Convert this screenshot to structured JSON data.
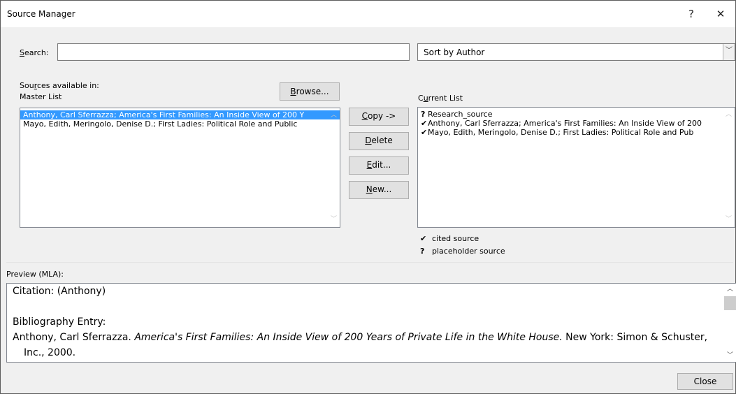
{
  "window": {
    "title": "Source Manager",
    "help": "?",
    "close": "✕"
  },
  "search": {
    "label_pre": "",
    "label_u": "S",
    "label_post": "earch:",
    "value": ""
  },
  "sort": {
    "selected": "Sort by Author"
  },
  "master": {
    "heading_pre": "Sou",
    "heading_u": "r",
    "heading_post": "ces available in:",
    "subheading": "Master List",
    "browse_u": "B",
    "browse_post": "rowse...",
    "items": [
      "Anthony, Carl Sferrazza; America's First Families: An Inside View of 200 Y",
      "Mayo, Edith, Meringolo, Denise D.; First Ladies: Political Role and Public"
    ]
  },
  "actions": {
    "copy_u": "C",
    "copy_post": "opy ->",
    "delete_u": "D",
    "delete_post": "elete",
    "edit_u": "E",
    "edit_post": "dit...",
    "new_u": "N",
    "new_post": "ew..."
  },
  "current": {
    "heading_pre": "C",
    "heading_u": "u",
    "heading_post": "rrent List",
    "items": [
      {
        "mark": "?",
        "text": "Research_source"
      },
      {
        "mark": "✔",
        "text": "Anthony, Carl Sferrazza; America's First Families: An Inside View of 200"
      },
      {
        "mark": "✔",
        "text": "Mayo, Edith, Meringolo, Denise D.; First Ladies: Political Role and Pub"
      }
    ]
  },
  "legend": {
    "cited_mark": "✔",
    "cited_text": "cited source",
    "placeholder_mark": "?",
    "placeholder_text": "placeholder source"
  },
  "preview": {
    "label": "Preview (MLA):",
    "citation": "Citation:  (Anthony)",
    "bib_label": "Bibliography Entry:",
    "bib_pre": "Anthony, Carl Sferrazza. ",
    "bib_title": "America's First Families: An Inside View of 200 Years of Private Life in the White House.",
    "bib_post": " New York: Simon & Schuster,",
    "bib_cont": "Inc., 2000."
  },
  "footer": {
    "close_label": "Close"
  }
}
